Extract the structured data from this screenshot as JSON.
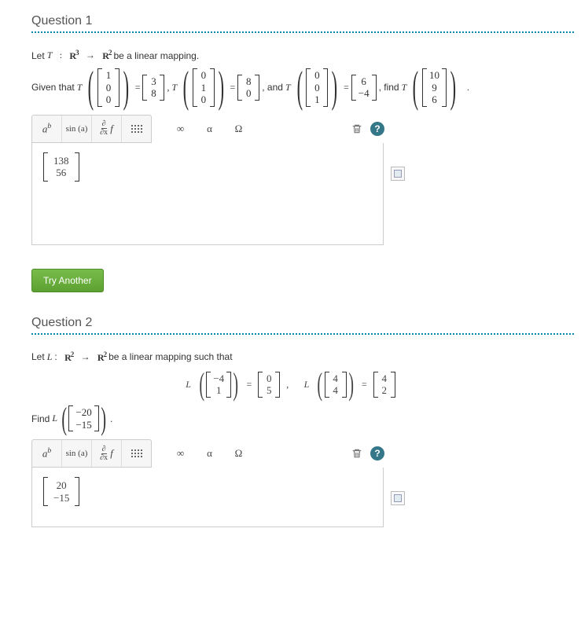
{
  "q1": {
    "heading": "Question 1",
    "intro_prefix": "Let ",
    "T": "T",
    "colon": ":",
    "R": "R",
    "sup3": "3",
    "arrow": "→",
    "sup2": "2",
    "intro_suffix": " be a linear mapping.",
    "given_that": "Given that ",
    "v1": [
      "1",
      "0",
      "0"
    ],
    "r1": [
      "3",
      "8"
    ],
    "v2": [
      "0",
      "1",
      "0"
    ],
    "r2": [
      "8",
      "0"
    ],
    "v3": [
      "0",
      "0",
      "1"
    ],
    "r3": [
      "6",
      "−4"
    ],
    "and": ", and ",
    "find": ", find ",
    "v4": [
      "10",
      "9",
      "6"
    ],
    "comma": ",",
    "eq": "=",
    "period": ".",
    "answer": [
      "138",
      "56"
    ]
  },
  "toolbar": {
    "sup_demo": "a",
    "sup_demo_exp": "b",
    "sin": "sin (a)",
    "partial_num": "∂",
    "partial_den": "∂x",
    "f": "f",
    "inf": "∞",
    "alpha": "α",
    "omega": "Ω"
  },
  "try_another": "Try Another",
  "q2": {
    "heading": "Question 2",
    "intro_prefix": "Let ",
    "L": "L",
    "R": "R",
    "sup2a": "2",
    "arrow": "→",
    "sup2b": "2",
    "intro_suffix": " be a linear mapping such that",
    "v1": [
      "−4",
      "1"
    ],
    "r1": [
      "0",
      "5"
    ],
    "v2": [
      "4",
      "4"
    ],
    "r2": [
      "4",
      "2"
    ],
    "find_prefix": "Find ",
    "v3": [
      "−20",
      "−15"
    ],
    "eq": "=",
    "comma": ",",
    "period": ".",
    "answer": [
      "20",
      "−15"
    ]
  }
}
